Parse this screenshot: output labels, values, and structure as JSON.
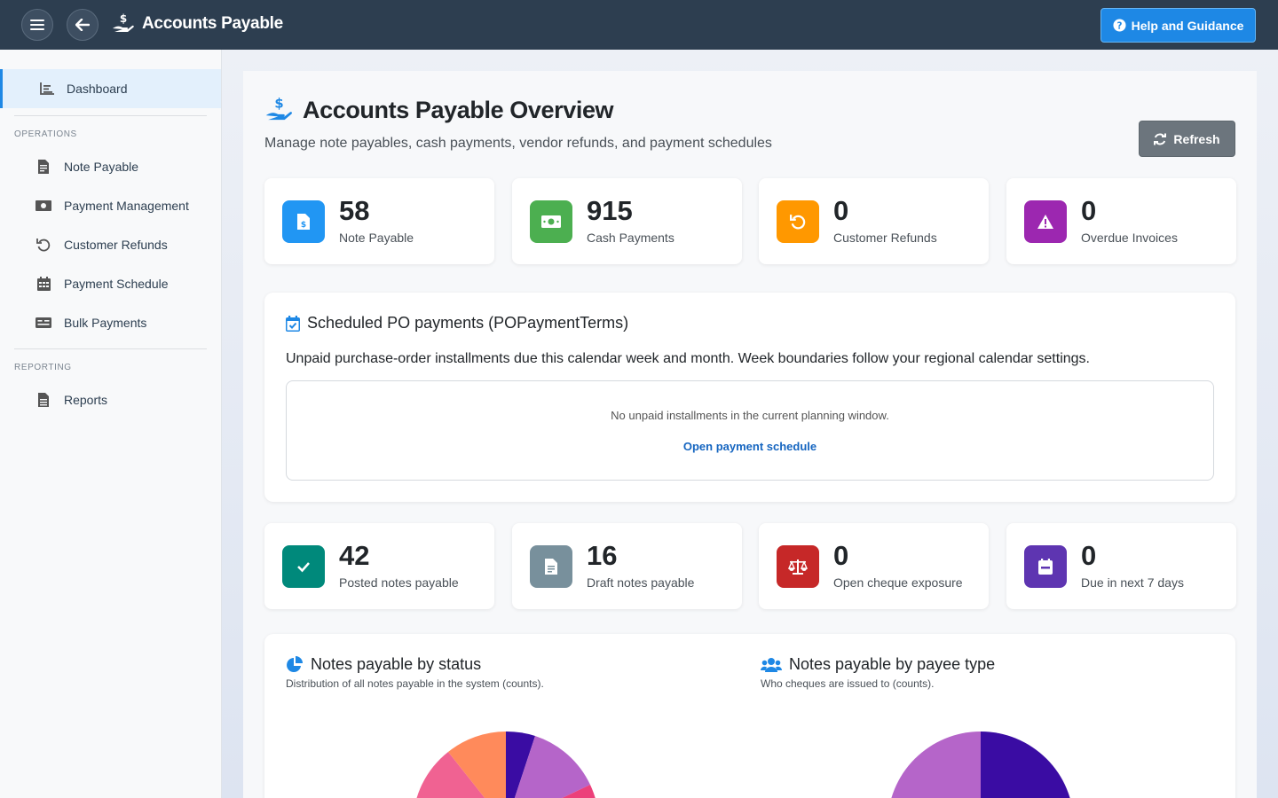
{
  "app": {
    "title": "Accounts Payable",
    "help_label": "Help and Guidance"
  },
  "sidebar": {
    "active": {
      "label": "Dashboard",
      "icon": "chart-line-icon"
    },
    "sections": [
      {
        "label": "OPERATIONS",
        "items": [
          {
            "label": "Note Payable",
            "icon": "file-invoice-icon"
          },
          {
            "label": "Payment Management",
            "icon": "money-bill-icon"
          },
          {
            "label": "Customer Refunds",
            "icon": "undo-icon"
          },
          {
            "label": "Payment Schedule",
            "icon": "calendar-icon"
          },
          {
            "label": "Bulk Payments",
            "icon": "money-check-icon"
          }
        ]
      },
      {
        "label": "REPORTING",
        "items": [
          {
            "label": "Reports",
            "icon": "file-alt-icon"
          }
        ]
      }
    ]
  },
  "page": {
    "title": "Accounts Payable Overview",
    "subtitle": "Manage note payables, cash payments, vendor refunds, and payment schedules",
    "refresh_label": "Refresh"
  },
  "stats_top": [
    {
      "value": "58",
      "label": "Note Payable",
      "color": "#2196f3",
      "icon": "file-invoice-dollar-icon"
    },
    {
      "value": "915",
      "label": "Cash Payments",
      "color": "#4caf50",
      "icon": "money-bill-icon"
    },
    {
      "value": "0",
      "label": "Customer Refunds",
      "color": "#ff9800",
      "icon": "undo-icon"
    },
    {
      "value": "0",
      "label": "Overdue Invoices",
      "color": "#9c27b0",
      "icon": "warning-icon"
    }
  ],
  "schedule": {
    "title": "Scheduled PO payments (POPaymentTerms)",
    "description": "Unpaid purchase-order installments due this calendar week and month. Week boundaries follow your regional calendar settings.",
    "empty_text": "No unpaid installments in the current planning window.",
    "link_label": "Open payment schedule"
  },
  "stats_bottom": [
    {
      "value": "42",
      "label": "Posted notes payable",
      "color": "#00897b",
      "icon": "check-icon"
    },
    {
      "value": "16",
      "label": "Draft notes payable",
      "color": "#78909c",
      "icon": "file-icon"
    },
    {
      "value": "0",
      "label": "Open cheque exposure",
      "color": "#c62828",
      "icon": "balance-scale-icon"
    },
    {
      "value": "0",
      "label": "Due in next 7 days",
      "color": "#5e35b1",
      "icon": "calendar-icon"
    }
  ],
  "charts": {
    "status": {
      "title": "Notes payable by status",
      "subtitle": "Distribution of all notes payable in the system (counts).",
      "icon": "pie-chart-icon"
    },
    "payee": {
      "title": "Notes payable by payee type",
      "subtitle": "Who cheques are issued to (counts).",
      "icon": "users-icon"
    }
  },
  "chart_data": [
    {
      "type": "pie",
      "title": "Notes payable by status",
      "note": "Only top of pie visible; slice values not legible",
      "colors": [
        "#3a0ca3",
        "#b565c9",
        "#ec407a",
        "#ff8a5b"
      ]
    },
    {
      "type": "pie",
      "title": "Notes payable by payee type",
      "note": "Only top of pie visible; slice values not legible",
      "colors": [
        "#3a0ca3",
        "#b565c9"
      ]
    }
  ]
}
